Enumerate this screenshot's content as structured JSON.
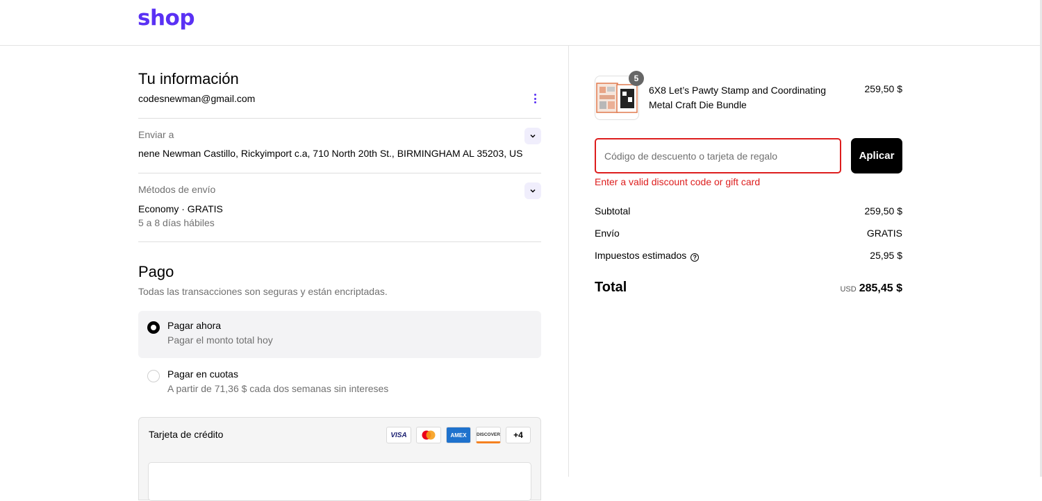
{
  "header": {
    "logo": "shop"
  },
  "contact": {
    "title": "Tu información",
    "email": "codesnewman@gmail.com"
  },
  "ship_to": {
    "label": "Enviar a",
    "address": "nene Newman Castillo, Rickyimport c.a, 710 North 20th St., BIRMINGHAM AL 35203, US"
  },
  "shipping_method": {
    "label": "Métodos de envío",
    "method": "Economy · GRATIS",
    "eta": "5 a 8 días hábiles"
  },
  "payment": {
    "title": "Pago",
    "subtitle": "Todas las transacciones son seguras y están encriptadas.",
    "options": [
      {
        "title": "Pagar ahora",
        "desc": "Pagar el monto total hoy",
        "selected": true
      },
      {
        "title": "Pagar en cuotas",
        "desc": "A partir de 71,36 $ cada dos semanas sin intereses",
        "selected": false
      }
    ],
    "card": {
      "title": "Tarjeta de crédito",
      "brands": [
        "VISA",
        "mastercard",
        "AMEX",
        "DISCOVER",
        "+4"
      ]
    }
  },
  "order": {
    "item": {
      "name": "6X8 Let’s Pawty Stamp and Coordinating Metal Craft Die Bundle",
      "price": "259,50 $",
      "quantity": "5"
    },
    "discount": {
      "placeholder": "Código de descuento o tarjeta de regalo",
      "button": "Aplicar",
      "error": "Enter a valid discount code or gift card"
    },
    "summary": {
      "subtotal_label": "Subtotal",
      "subtotal": "259,50 $",
      "shipping_label": "Envío",
      "shipping": "GRATIS",
      "taxes_label": "Impuestos estimados",
      "taxes": "25,95 $",
      "total_label": "Total",
      "currency": "USD",
      "total": "285,45 $"
    }
  },
  "colors": {
    "brand": "#5a31f4",
    "error": "#dd1d1d",
    "button": "#000000"
  }
}
